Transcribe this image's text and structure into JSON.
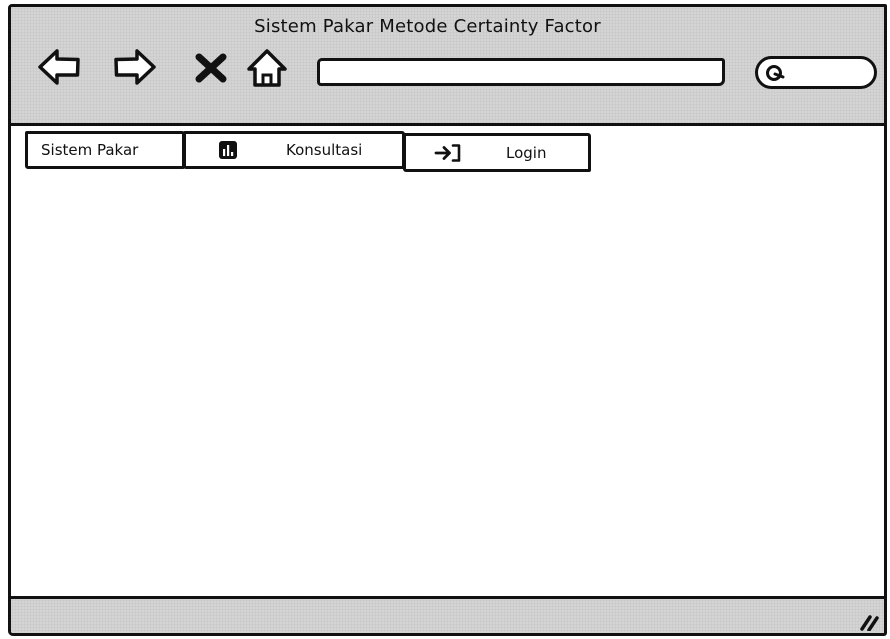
{
  "window": {
    "title": "Sistem Pakar Metode Certainty Factor"
  },
  "toolbar": {
    "back_icon": "arrow-left-icon",
    "forward_icon": "arrow-right-icon",
    "stop_icon": "close-icon",
    "home_icon": "home-icon",
    "address_value": "",
    "search_icon": "search-icon",
    "search_value": ""
  },
  "menu": {
    "items": [
      {
        "label": "Sistem Pakar",
        "icon": ""
      },
      {
        "label": "Konsultasi",
        "icon": "bar-chart-icon"
      },
      {
        "label": "Login",
        "icon": "login-icon"
      }
    ]
  },
  "colors": {
    "chrome_gray": "#d4d4d4",
    "outline": "#111111",
    "content_bg": "#ffffff"
  }
}
